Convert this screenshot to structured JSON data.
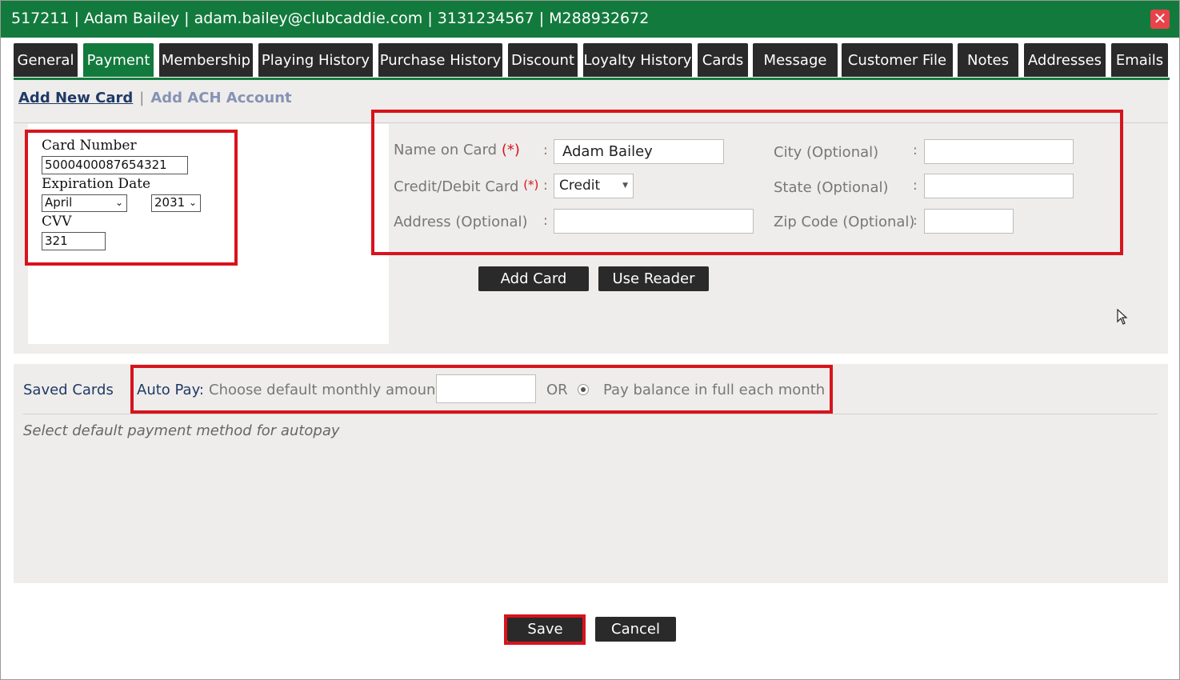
{
  "window": {
    "title": "517211 | Adam Bailey | adam.bailey@clubcaddie.com | 3131234567 | M288932672",
    "close_icon": "close-icon"
  },
  "tabs": [
    {
      "label": "General"
    },
    {
      "label": "Payment",
      "active": true
    },
    {
      "label": "Membership"
    },
    {
      "label": "Playing History"
    },
    {
      "label": "Purchase History"
    },
    {
      "label": "Discount"
    },
    {
      "label": "Loyalty History"
    },
    {
      "label": "Cards"
    },
    {
      "label": "Message"
    },
    {
      "label": "Customer File"
    },
    {
      "label": "Notes"
    },
    {
      "label": "Addresses"
    },
    {
      "label": "Emails"
    }
  ],
  "subnav": {
    "add_new_card": "Add New Card",
    "separator": "|",
    "add_ach": "Add ACH Account"
  },
  "card_entry": {
    "card_number_label": "Card Number",
    "card_number_value": "5000400087654321",
    "expiration_label": "Expiration Date",
    "exp_month": "April",
    "exp_year": "2031",
    "cvv_label": "CVV",
    "cvv_value": "321"
  },
  "form": {
    "name_label": "Name on Card",
    "name_required": "(*)",
    "name_value": "Adam Bailey",
    "card_type_label": "Credit/Debit Card",
    "card_type_required": "(*)",
    "card_type_value": "Credit",
    "address_label": "Address (Optional)",
    "address_value": "",
    "city_label": "City (Optional)",
    "city_value": "",
    "state_label": "State (Optional)",
    "state_value": "",
    "zip_label": "Zip Code (Optional)",
    "zip_value": "",
    "colon": ":"
  },
  "buttons": {
    "add_card": "Add Card",
    "use_reader": "Use Reader",
    "save": "Save",
    "cancel": "Cancel"
  },
  "saved_cards": {
    "title": "Saved Cards",
    "autopay_label": "Auto Pay:",
    "choose_amount": "Choose default monthly amount:",
    "amount_value": "",
    "or": "OR",
    "pay_balance": "Pay balance in full each month",
    "pay_balance_selected": true,
    "hint": "Select default payment method for autopay"
  },
  "colors": {
    "brand_green": "#137a3d",
    "tab_dark": "#2a2a2a",
    "highlight_red": "#d7141d",
    "link_blue": "#1f3a66"
  }
}
